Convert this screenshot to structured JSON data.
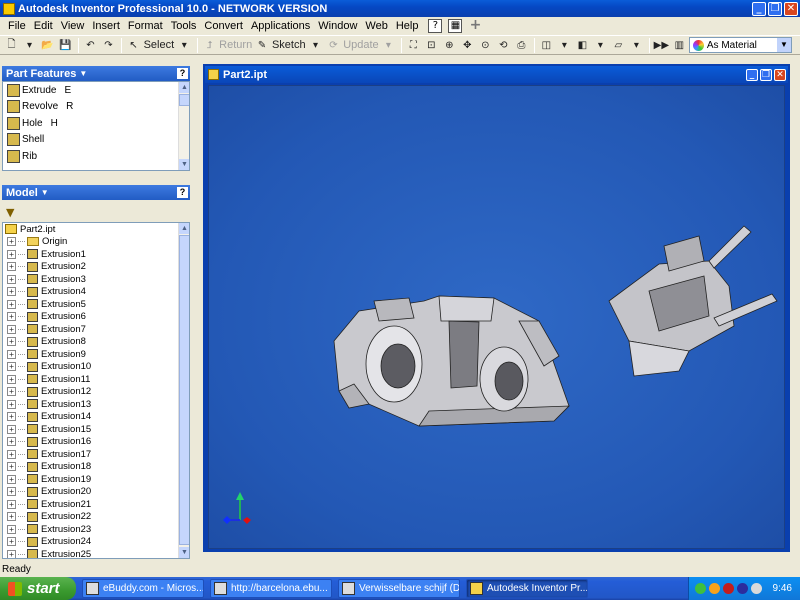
{
  "window": {
    "title": "Autodesk Inventor Professional 10.0 - NETWORK VERSION"
  },
  "menu": [
    "File",
    "Edit",
    "View",
    "Insert",
    "Format",
    "Tools",
    "Convert",
    "Applications",
    "Window",
    "Web",
    "Help"
  ],
  "toolbar": {
    "select_label": "Select",
    "return_label": "Return",
    "sketch_label": "Sketch",
    "update_label": "Update",
    "material_value": "As Material"
  },
  "panel_features": {
    "header": "Part Features",
    "items": [
      {
        "label": "Extrude",
        "key": "E"
      },
      {
        "label": "Revolve",
        "key": "R"
      },
      {
        "label": "Hole",
        "key": "H"
      },
      {
        "label": "Shell",
        "key": ""
      },
      {
        "label": "Rib",
        "key": ""
      }
    ]
  },
  "panel_model": {
    "header": "Model",
    "root": "Part2.ipt",
    "origin": "Origin",
    "items": [
      "Extrusion1",
      "Extrusion2",
      "Extrusion3",
      "Extrusion4",
      "Extrusion5",
      "Extrusion6",
      "Extrusion7",
      "Extrusion8",
      "Extrusion9",
      "Extrusion10",
      "Extrusion11",
      "Extrusion12",
      "Extrusion13",
      "Extrusion14",
      "Extrusion15",
      "Extrusion16",
      "Extrusion17",
      "Extrusion18",
      "Extrusion19",
      "Extrusion20",
      "Extrusion21",
      "Extrusion22",
      "Extrusion23",
      "Extrusion24",
      "Extrusion25"
    ]
  },
  "document": {
    "title": "Part2.ipt"
  },
  "status": {
    "text": "Ready"
  },
  "taskbar": {
    "start_label": "start",
    "tasks": [
      {
        "label": "eBuddy.com - Micros...",
        "active": false
      },
      {
        "label": "http://barcelona.ebu...",
        "active": false
      },
      {
        "label": "Verwisselbare schijf (D:)",
        "active": false
      },
      {
        "label": "Autodesk Inventor Pr...",
        "active": true
      }
    ],
    "clock": "9:46"
  },
  "colors": {
    "viewport_bg": "#2a60bd",
    "titlebar": "#0a5cd8",
    "taskbar": "#245dd7",
    "start": "#3a9a2f"
  }
}
